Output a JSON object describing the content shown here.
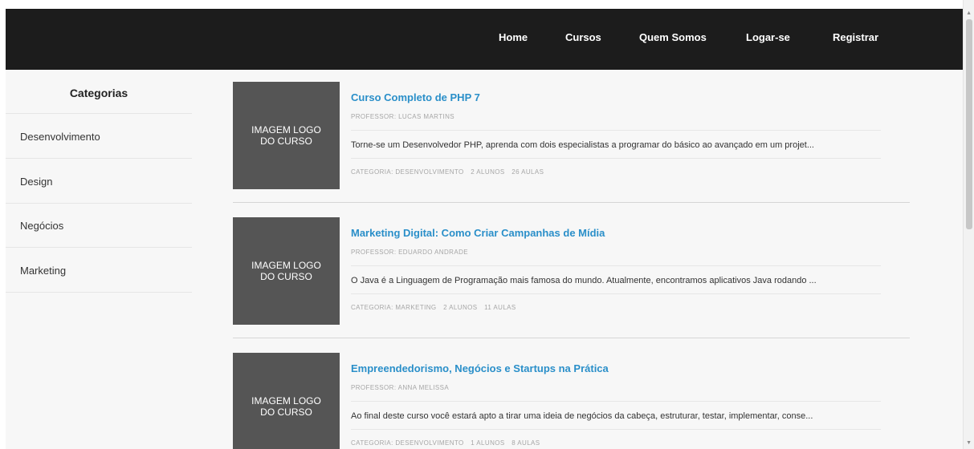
{
  "nav": {
    "items": [
      {
        "label": "Home"
      },
      {
        "label": "Cursos"
      },
      {
        "label": "Quem Somos"
      },
      {
        "label": "Logar-se"
      },
      {
        "label": "Registrar"
      }
    ]
  },
  "sidebar": {
    "title": "Categorias",
    "items": [
      {
        "label": "Desenvolvimento"
      },
      {
        "label": "Design"
      },
      {
        "label": "Negócios"
      },
      {
        "label": "Marketing"
      }
    ]
  },
  "courses": [
    {
      "image_text": "IMAGEM LOGO DO CURSO",
      "title": "Curso Completo de PHP 7",
      "professor": "PROFESSOR: LUCAS MARTINS",
      "description": "Torne-se um Desenvolvedor PHP, aprenda com dois especialistas a programar do básico ao avançado em um projet...",
      "category": "CATEGORIA: DESENVOLVIMENTO",
      "students": "2 ALUNOS",
      "lessons": "26 AULAS"
    },
    {
      "image_text": "IMAGEM LOGO DO CURSO",
      "title": "Marketing Digital: Como Criar Campanhas de Mídia",
      "professor": "PROFESSOR: EDUARDO ANDRADE",
      "description": "O Java é a Linguagem de Programação mais famosa do mundo. Atualmente, encontramos aplicativos Java rodando ...",
      "category": "CATEGORIA: MARKETING",
      "students": "2 ALUNOS",
      "lessons": "11 AULAS"
    },
    {
      "image_text": "IMAGEM LOGO DO CURSO",
      "title": "Empreendedorismo, Negócios e Startups na Prática",
      "professor": "PROFESSOR: ANNA MELISSA",
      "description": "Ao final deste curso você estará apto a tirar uma ideia de negócios da cabeça, estruturar, testar, implementar, conse...",
      "category": "CATEGORIA: DESENVOLVIMENTO",
      "students": "1 ALUNOS",
      "lessons": "8 AULAS"
    }
  ],
  "colors": {
    "navbar_bg": "#1c1c1c",
    "content_bg": "#f7f7f7",
    "title_link": "#2a8fc9",
    "thumb_bg": "#555555"
  }
}
